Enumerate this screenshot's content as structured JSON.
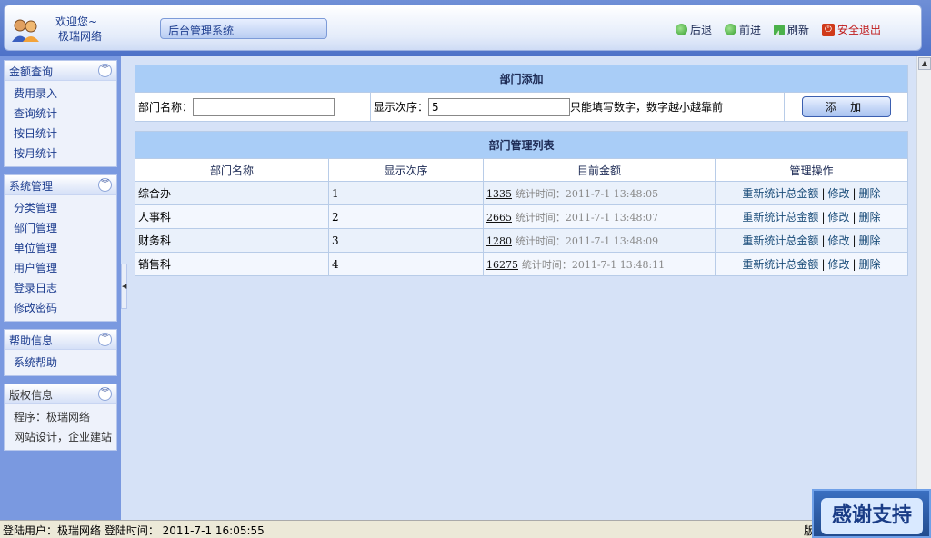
{
  "header": {
    "welcome": "欢迎您~",
    "user": "极瑞网络",
    "system_title": "后台管理系统",
    "nav": {
      "back": "后退",
      "forward": "前进",
      "refresh": "刷新",
      "logout": "安全退出"
    }
  },
  "sidebar": {
    "panels": [
      {
        "title": "金额查询",
        "items": [
          "费用录入",
          "查询统计",
          "按日统计",
          "按月统计"
        ]
      },
      {
        "title": "系统管理",
        "items": [
          "分类管理",
          "部门管理",
          "单位管理",
          "用户管理",
          "登录日志",
          "修改密码"
        ]
      },
      {
        "title": "帮助信息",
        "items": [
          "系统帮助"
        ]
      },
      {
        "title": "版权信息",
        "items": [
          "程序：极瑞网络",
          "网站设计，企业建站"
        ]
      }
    ]
  },
  "add_form": {
    "caption": "部门添加",
    "name_label": "部门名称：",
    "name_value": "",
    "order_label": "显示次序：",
    "order_value": "5",
    "hint": "只能填写数字，数字越小越靠前",
    "submit": "添 加"
  },
  "list": {
    "caption": "部门管理列表",
    "columns": [
      "部门名称",
      "显示次序",
      "目前金额",
      "管理操作"
    ],
    "rows": [
      {
        "name": "综合办",
        "order": "1",
        "amount": "1335",
        "time": "统计时间：2011-7-1 13:48:05"
      },
      {
        "name": "人事科",
        "order": "2",
        "amount": "2665",
        "time": "统计时间：2011-7-1 13:48:07"
      },
      {
        "name": "财务科",
        "order": "3",
        "amount": "1280",
        "time": "统计时间：2011-7-1 13:48:09"
      },
      {
        "name": "销售科",
        "order": "4",
        "amount": "16275",
        "time": "统计时间：2011-7-1 13:48:11"
      }
    ],
    "ops": {
      "recount": "重新统计总金额",
      "edit": "修改",
      "delete": "删除",
      "sep": "|"
    }
  },
  "footer": {
    "login_info": "登陆用户：极瑞网络  登陆时间： 2011-7-1 16:05:55",
    "right_text": "版"
  },
  "badge": "感谢支持"
}
